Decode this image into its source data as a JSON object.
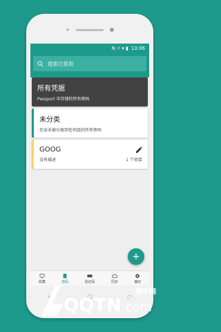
{
  "statusbar": {
    "icons": "N ⚡ ▾ ▮",
    "time": "13:06"
  },
  "search": {
    "placeholder": "搜索已禁用"
  },
  "cards": {
    "all": {
      "title": "所有凭据",
      "desc": "Passport 中存储的所有密码"
    },
    "uncategorized": {
      "title": "未分类",
      "desc": "包含未被分类到任何组的所有密码"
    },
    "goog": {
      "title": "GOOG",
      "desc": "没有描述",
      "count": "1 个项目",
      "accent": "#f4d56a"
    }
  },
  "fab": {
    "label": "+"
  },
  "nav": {
    "items": [
      {
        "label": "收藏",
        "icon": "heart-icon"
      },
      {
        "label": "密码",
        "icon": "book-icon",
        "active": true
      },
      {
        "label": "验证码",
        "icon": "pin-icon"
      },
      {
        "label": "同步",
        "icon": "cloud-icon"
      },
      {
        "label": "偏好",
        "icon": "gear-icon"
      }
    ]
  },
  "watermark": {
    "brand": "QQTN",
    "domain": ".com",
    "cn": "腾牛网"
  },
  "colors": {
    "primary": "#1e9a8c",
    "dark_card": "#424242"
  }
}
